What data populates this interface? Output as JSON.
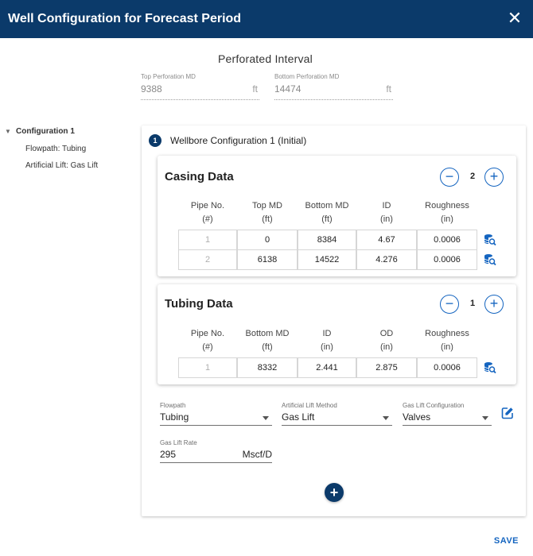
{
  "header": {
    "title": "Well Configuration for Forecast Period",
    "close_glyph": "✕"
  },
  "perforated": {
    "title": "Perforated Interval",
    "top": {
      "label": "Top Perforation MD",
      "value": "9388",
      "unit": "ft"
    },
    "bottom": {
      "label": "Bottom Perforation MD",
      "value": "14474",
      "unit": "ft"
    }
  },
  "tree": {
    "root": "Configuration 1",
    "caret": "▼",
    "children": [
      "Flowpath: Tubing",
      "Artificial Lift: Gas Lift"
    ]
  },
  "config": {
    "step": "1",
    "title": "Wellbore Configuration 1 (Initial)",
    "add_glyph": "+"
  },
  "casing": {
    "title": "Casing Data",
    "count": "2",
    "minus": "−",
    "plus": "+",
    "headers": [
      [
        "Pipe No.",
        "(#)"
      ],
      [
        "Top MD",
        "(ft)"
      ],
      [
        "Bottom MD",
        "(ft)"
      ],
      [
        "ID",
        "(in)"
      ],
      [
        "Roughness",
        "(in)"
      ]
    ],
    "rows": [
      [
        "1",
        "0",
        "8384",
        "4.67",
        "0.0006"
      ],
      [
        "2",
        "6138",
        "14522",
        "4.276",
        "0.0006"
      ]
    ]
  },
  "tubing": {
    "title": "Tubing Data",
    "count": "1",
    "minus": "−",
    "plus": "+",
    "headers": [
      [
        "Pipe No.",
        "(#)"
      ],
      [
        "Bottom MD",
        "(ft)"
      ],
      [
        "ID",
        "(in)"
      ],
      [
        "OD",
        "(in)"
      ],
      [
        "Roughness",
        "(in)"
      ]
    ],
    "rows": [
      [
        "1",
        "8332",
        "2.441",
        "2.875",
        "0.0006"
      ]
    ]
  },
  "fields": {
    "flowpath": {
      "label": "Flowpath",
      "value": "Tubing"
    },
    "lift_method": {
      "label": "Artificial Lift Method",
      "value": "Gas Lift"
    },
    "lift_config": {
      "label": "Gas Lift Configuration",
      "value": "Valves"
    },
    "lift_rate": {
      "label": "Gas Lift Rate",
      "value": "295",
      "unit": "Mscf/D"
    }
  },
  "footer": {
    "save": "SAVE"
  },
  "colors": {
    "primary": "#0b3a6a",
    "accent": "#1565c0"
  },
  "icons": {
    "row_action": "database-search-icon",
    "edit": "edit-icon",
    "close": "close-icon"
  }
}
